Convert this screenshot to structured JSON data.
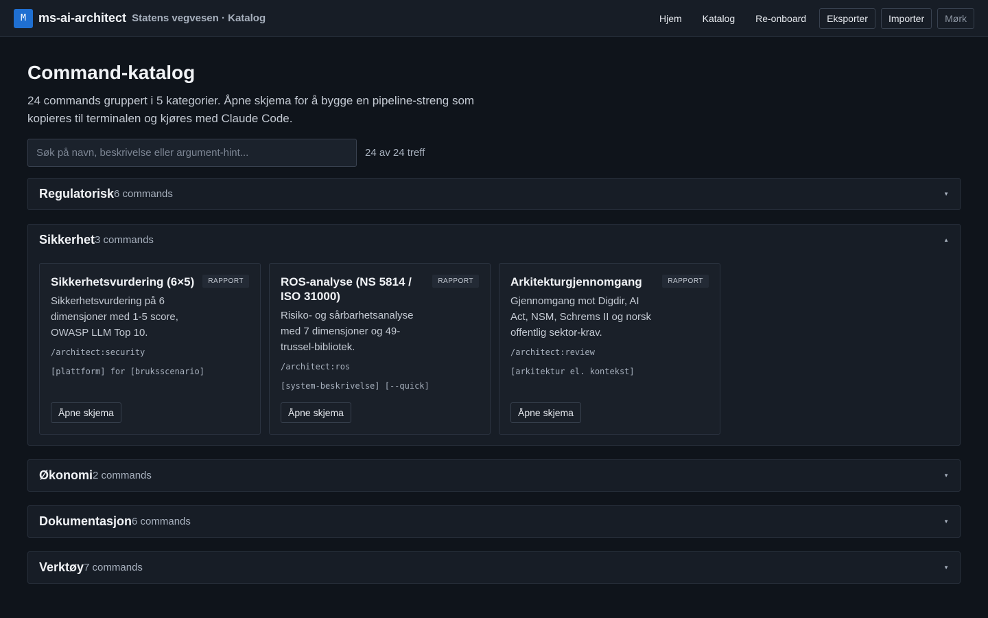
{
  "header": {
    "logo_letter": "M",
    "app_name": "ms-ai-architect",
    "breadcrumb": "Statens vegvesen · Katalog",
    "nav_links": [
      "Hjem",
      "Katalog",
      "Re-onboard"
    ],
    "export_label": "Eksporter",
    "import_label": "Importer",
    "theme_label": "Mørk"
  },
  "page": {
    "title": "Command-katalog",
    "intro": "24 commands gruppert i 5 kategorier. Åpne skjema for å bygge en pipeline-streng som kopieres til terminalen og kjøres med Claude Code."
  },
  "search": {
    "placeholder": "Søk på navn, beskrivelse eller argument-hint...",
    "value": "",
    "hits": "24 av 24 treff"
  },
  "categories": [
    {
      "name": "Regulatorisk",
      "count": "6 commands",
      "expanded": false
    },
    {
      "name": "Sikkerhet",
      "count": "3 commands",
      "expanded": true,
      "cards": [
        {
          "title": "Sikkerhetsvurdering (6×5)",
          "badge": "RAPPORT",
          "description": "Sikkerhetsvurdering på 6 dimensjoner med 1-5 score, OWASP LLM Top 10.",
          "command": "/architect:security",
          "args": "[plattform] for [bruksscenario]",
          "button": "Åpne skjema"
        },
        {
          "title": "ROS-analyse (NS 5814 / ISO 31000)",
          "badge": "RAPPORT",
          "description": "Risiko- og sårbarhetsanalyse med 7 dimensjoner og 49-trussel-bibliotek.",
          "command": "/architect:ros",
          "args": "[system-beskrivelse] [--quick]",
          "button": "Åpne skjema"
        },
        {
          "title": "Arkitekturgjennomgang",
          "badge": "RAPPORT",
          "description": "Gjennomgang mot Digdir, AI Act, NSM, Schrems II og norsk offentlig sektor-krav.",
          "command": "/architect:review",
          "args": "[arkitektur el. kontekst]",
          "button": "Åpne skjema"
        }
      ]
    },
    {
      "name": "Økonomi",
      "count": "2 commands",
      "expanded": false
    },
    {
      "name": "Dokumentasjon",
      "count": "6 commands",
      "expanded": false
    },
    {
      "name": "Verktøy",
      "count": "7 commands",
      "expanded": false
    }
  ],
  "icons": {
    "collapsed": "chevron-down-icon",
    "expanded": "chevron-up-icon"
  },
  "colors": {
    "accent": "#1f6fd1",
    "background": "#0f141b",
    "panel": "#171d26"
  }
}
